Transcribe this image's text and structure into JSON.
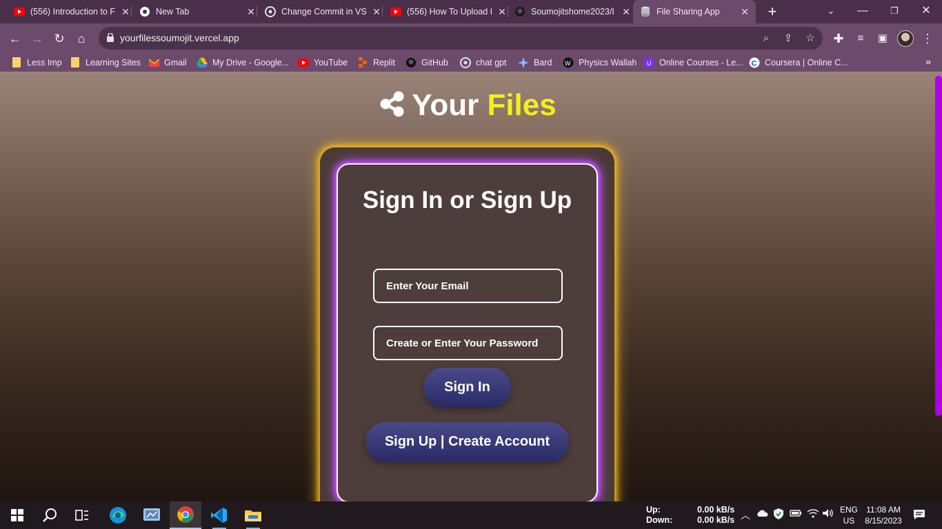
{
  "browser": {
    "tabs": [
      {
        "title": "(556) Introduction to F",
        "icon": "youtube-icon"
      },
      {
        "title": "New Tab",
        "icon": "chrome-icon"
      },
      {
        "title": "Change Commit in VS",
        "icon": "chatgpt-icon"
      },
      {
        "title": "(556) How To Upload I",
        "icon": "youtube-icon"
      },
      {
        "title": "Soumojitshome2023/I",
        "icon": "github-icon"
      },
      {
        "title": "File Sharing App",
        "icon": "database-icon"
      }
    ],
    "url": "yourfilessoumojit.vercel.app",
    "bookmarks": [
      {
        "label": "Less Imp",
        "icon": "folder-icon"
      },
      {
        "label": "Learning Sites",
        "icon": "folder-icon"
      },
      {
        "label": "Gmail",
        "icon": "gmail-icon"
      },
      {
        "label": "My Drive - Google...",
        "icon": "drive-icon"
      },
      {
        "label": "YouTube",
        "icon": "youtube-icon"
      },
      {
        "label": "Replit",
        "icon": "replit-icon"
      },
      {
        "label": "GitHub",
        "icon": "github-icon"
      },
      {
        "label": "chat gpt",
        "icon": "chatgpt-icon"
      },
      {
        "label": "Bard",
        "icon": "bard-icon"
      },
      {
        "label": "Physics Wallah",
        "icon": "pw-icon"
      },
      {
        "label": "Online Courses - Le...",
        "icon": "udemy-icon"
      },
      {
        "label": "Coursera | Online C...",
        "icon": "coursera-icon"
      }
    ]
  },
  "page": {
    "brand_your": "Your",
    "brand_files": "Files",
    "card_title": "Sign In or Sign Up",
    "email_placeholder": "Enter Your Email",
    "password_placeholder": "Create or Enter Your Password",
    "sign_in_label": "Sign In",
    "sign_up_label": "Sign Up | Create Account"
  },
  "taskbar": {
    "net_up_label": "Up:",
    "net_down_label": "Down:",
    "net_up_value": "0.00 kB/s",
    "net_down_value": "0.00 kB/s",
    "lang_1": "ENG",
    "lang_2": "US",
    "time": "11:08 AM",
    "date": "8/15/2023"
  },
  "colors": {
    "accent_yellow": "#f6ef1a",
    "outer_glow": "#f3b91d",
    "inner_glow": "#c04cff",
    "button": "#3a3a78",
    "scrollbar": "#b100e8"
  }
}
